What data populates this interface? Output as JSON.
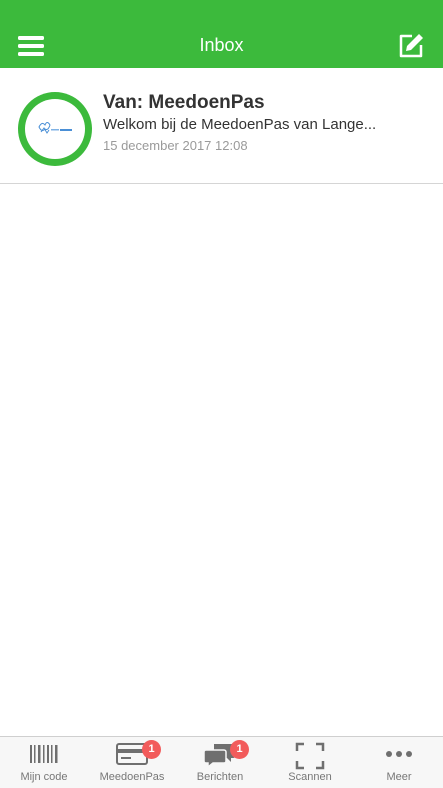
{
  "header": {
    "title": "Inbox",
    "background_color": "#3cba3c",
    "menu_icon": "hamburger-menu-icon",
    "compose_icon": "compose-edit-icon"
  },
  "messages": [
    {
      "from": "Van: MeedoenPas",
      "preview": "Welkom bij de MeedoenPas van Lange...",
      "date": "15 december 2017 12:08",
      "avatar_icon": "organization-logo-icon"
    }
  ],
  "tabbar": {
    "tabs": [
      {
        "label": "Mijn code",
        "icon": "barcode-icon"
      },
      {
        "label": "MeedoenPas",
        "icon": "card-icon",
        "badge": "1"
      },
      {
        "label": "Berichten",
        "icon": "chat-bubbles-icon",
        "badge": "1"
      },
      {
        "label": "Scannen",
        "icon": "scan-frame-icon"
      },
      {
        "label": "Meer",
        "icon": "more-dots-icon"
      }
    ],
    "badge_color": "#f25b5b"
  }
}
